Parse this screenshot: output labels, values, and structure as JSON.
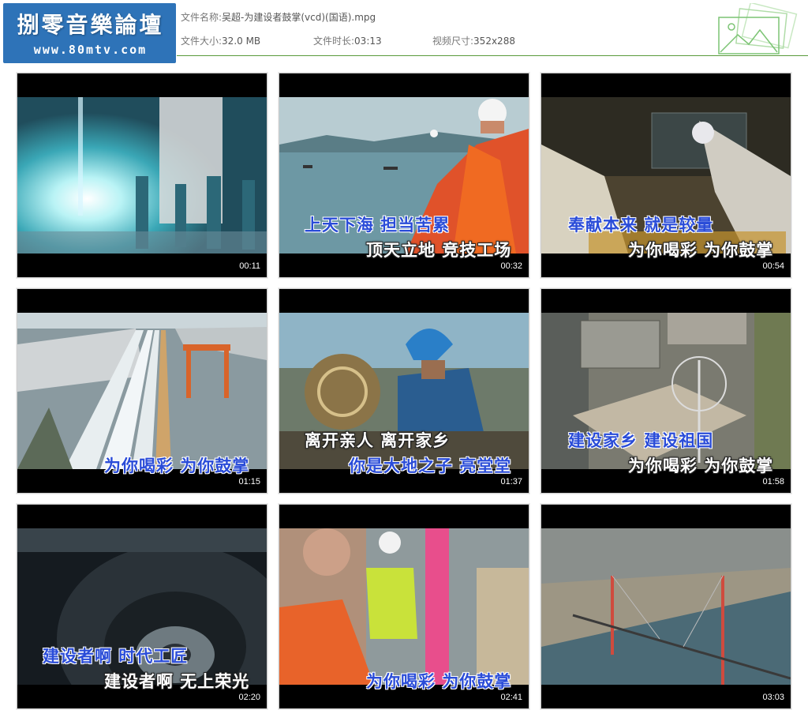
{
  "logo": {
    "title": "捌零音樂論壇",
    "url": "www.80mtv.com"
  },
  "file": {
    "name_label": "文件名称:",
    "name_value": "吴超-为建设者鼓掌(vcd)(国语).mpg",
    "size_label": "文件大小:",
    "size_value": "32.0 MB",
    "duration_label": "文件时长:",
    "duration_value": "03:13",
    "dims_label": "视频尺寸:",
    "dims_value": "352x288"
  },
  "thumbnails": [
    {
      "time": "00:11",
      "lyrics": []
    },
    {
      "time": "00:32",
      "lyrics": [
        "上天下海 担当苦累",
        "顶天立地 竞技工场"
      ]
    },
    {
      "time": "00:54",
      "lyrics": [
        "奉献本来 就是较量",
        "为你喝彩 为你鼓掌"
      ]
    },
    {
      "time": "01:15",
      "lyrics": [
        "为你喝彩 为你鼓掌"
      ]
    },
    {
      "time": "01:37",
      "lyrics": [
        "离开亲人 离开家乡",
        "你是大地之子 亮堂堂"
      ]
    },
    {
      "time": "01:58",
      "lyrics": [
        "建设家乡 建设祖国",
        "为你喝彩 为你鼓掌"
      ]
    },
    {
      "time": "02:20",
      "lyrics": [
        "建设者啊 时代工匠",
        "建设者啊 无上荣光"
      ]
    },
    {
      "time": "02:41",
      "lyrics": [
        "为你喝彩 为你鼓掌"
      ]
    },
    {
      "time": "03:03",
      "lyrics": []
    }
  ]
}
